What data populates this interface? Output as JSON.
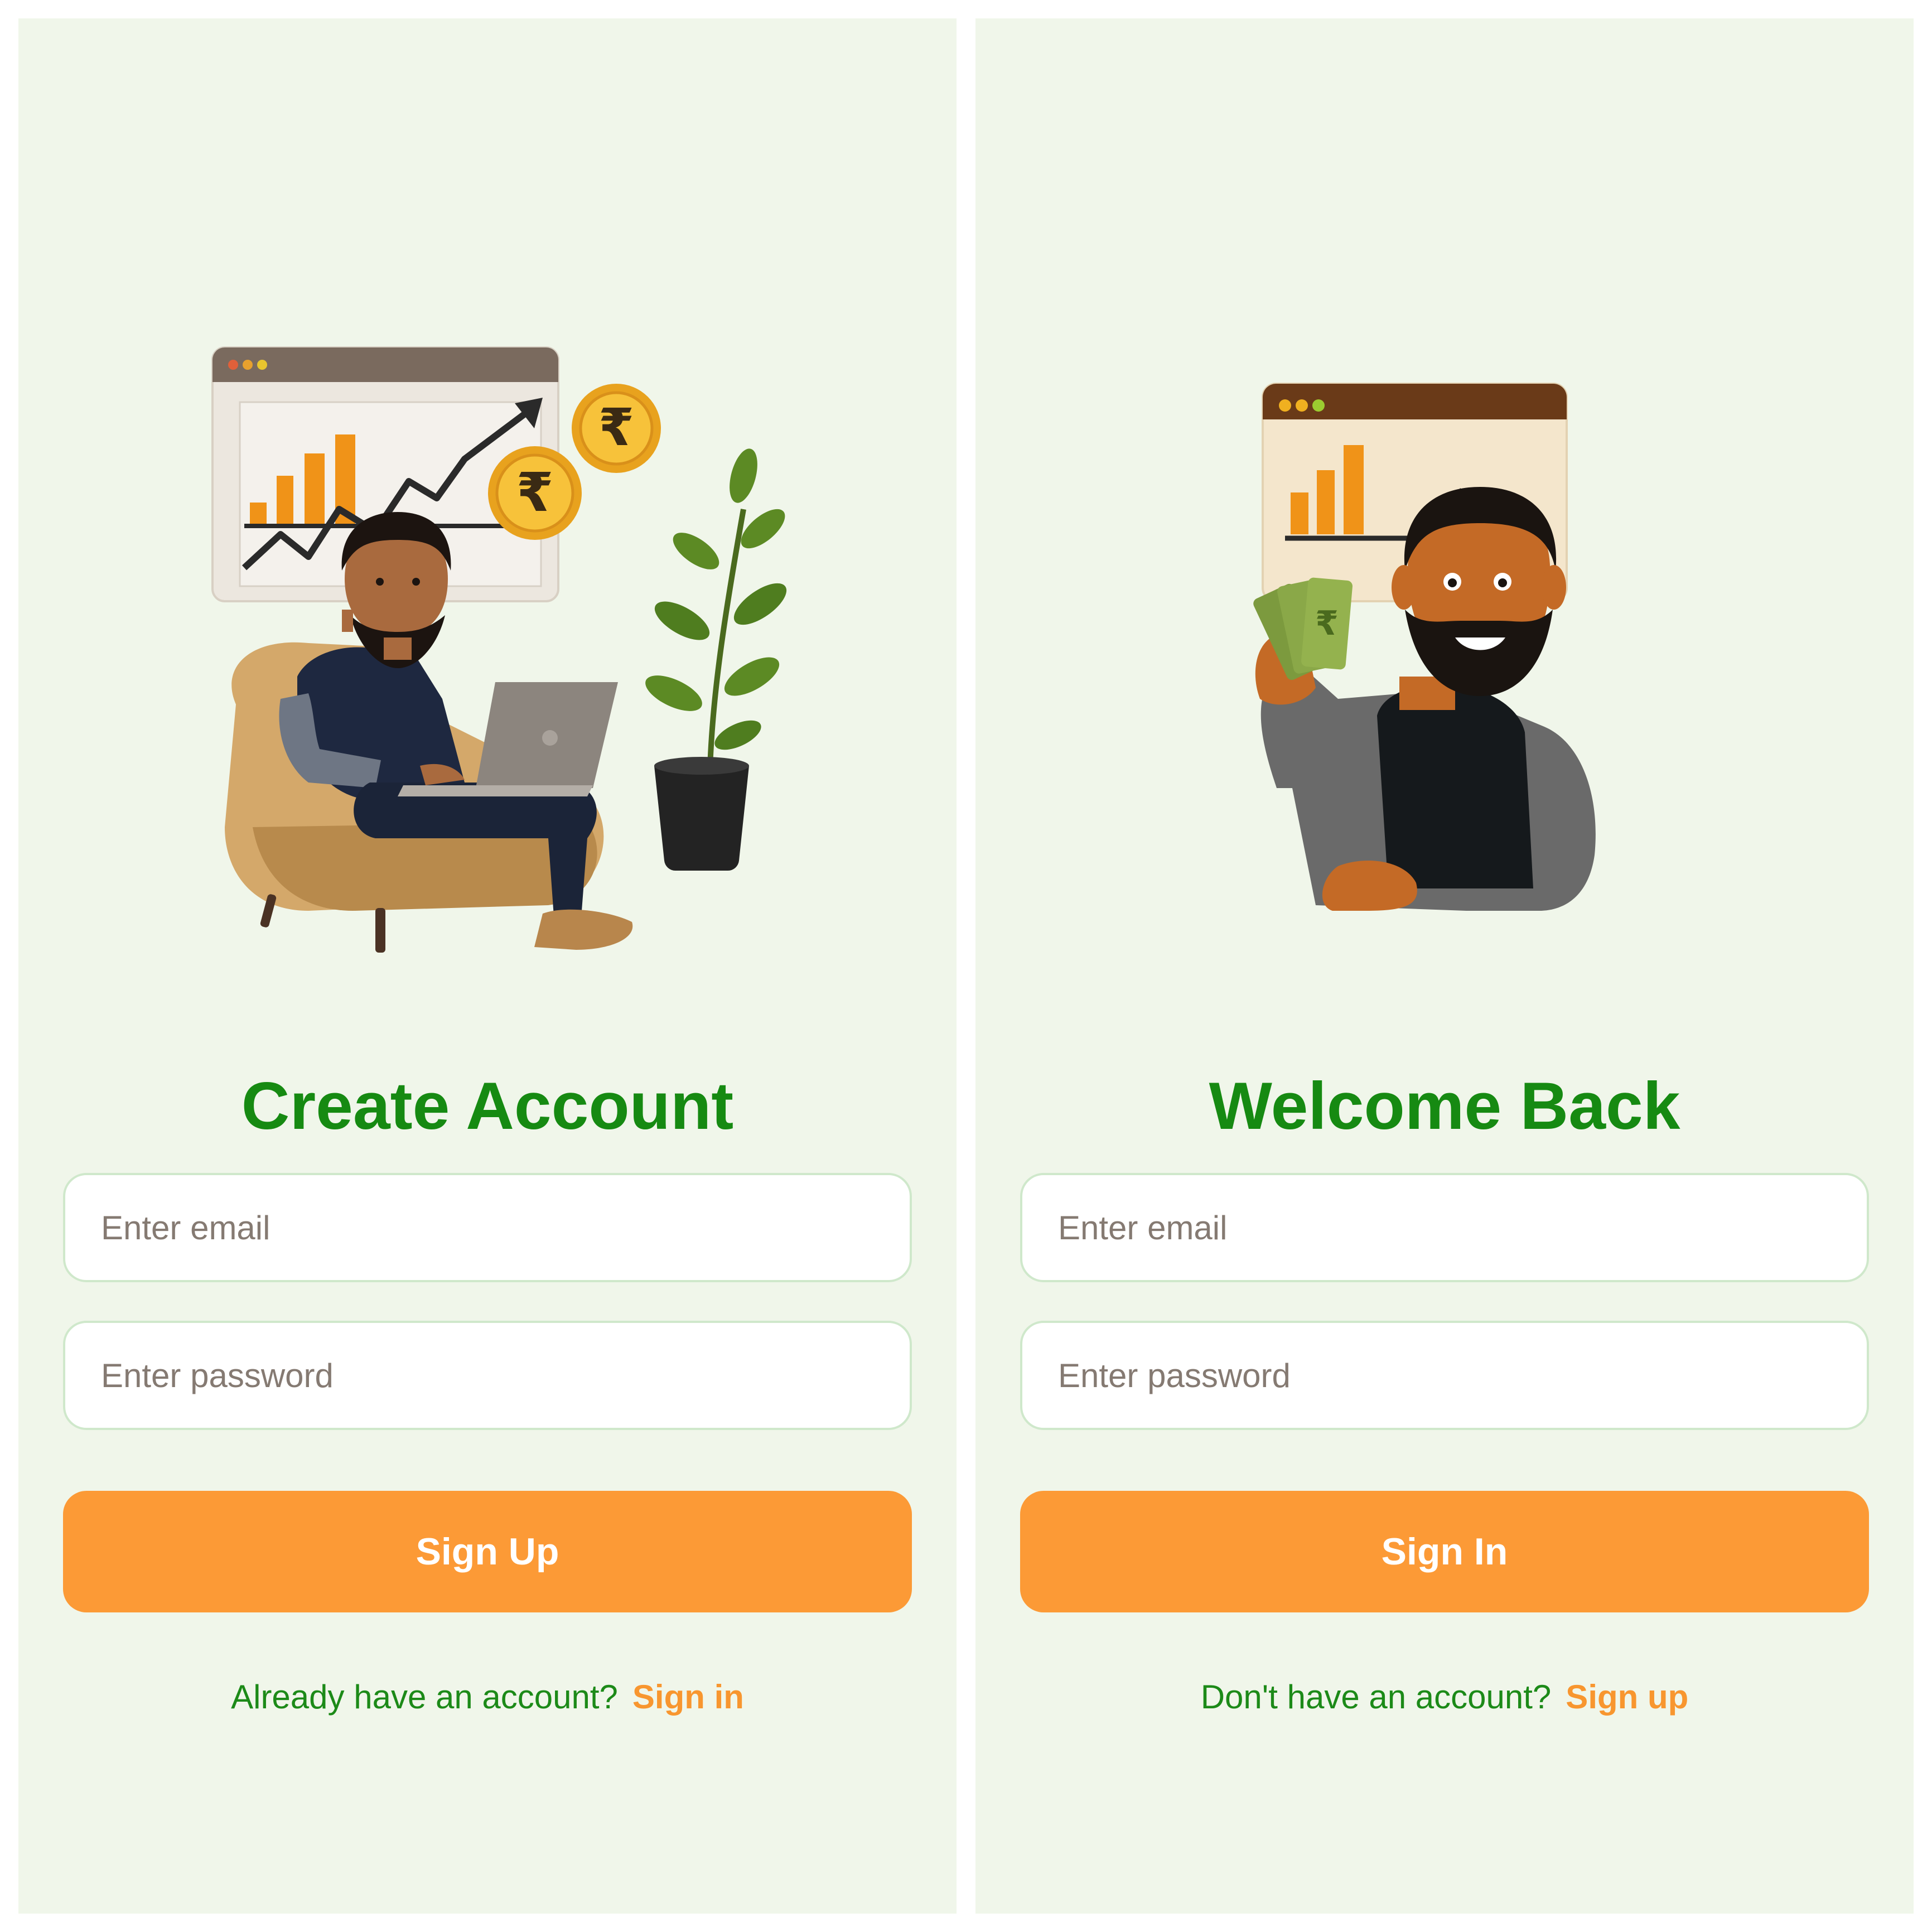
{
  "signup": {
    "title": "Create Account",
    "email_placeholder": "Enter email",
    "password_placeholder": "Enter password",
    "button_label": "Sign Up",
    "prompt_text": "Already have an account?",
    "link_text": "Sign in"
  },
  "signin": {
    "title": "Welcome Back",
    "email_placeholder": "Enter email",
    "password_placeholder": "Enter password",
    "button_label": "Sign In",
    "prompt_text": "Don't have an account?",
    "link_text": "Sign up"
  },
  "colors": {
    "background": "#f0f6ea",
    "heading_green": "#168a12",
    "accent_orange": "#fc9a36",
    "link_orange": "#f8962f",
    "field_border": "#cfe8cb"
  },
  "icons": {
    "signup_illustration": "man-on-laptop-with-growth-chart-and-rupee-coins",
    "signin_illustration": "smiling-man-holding-rupee-notes-with-chart"
  }
}
